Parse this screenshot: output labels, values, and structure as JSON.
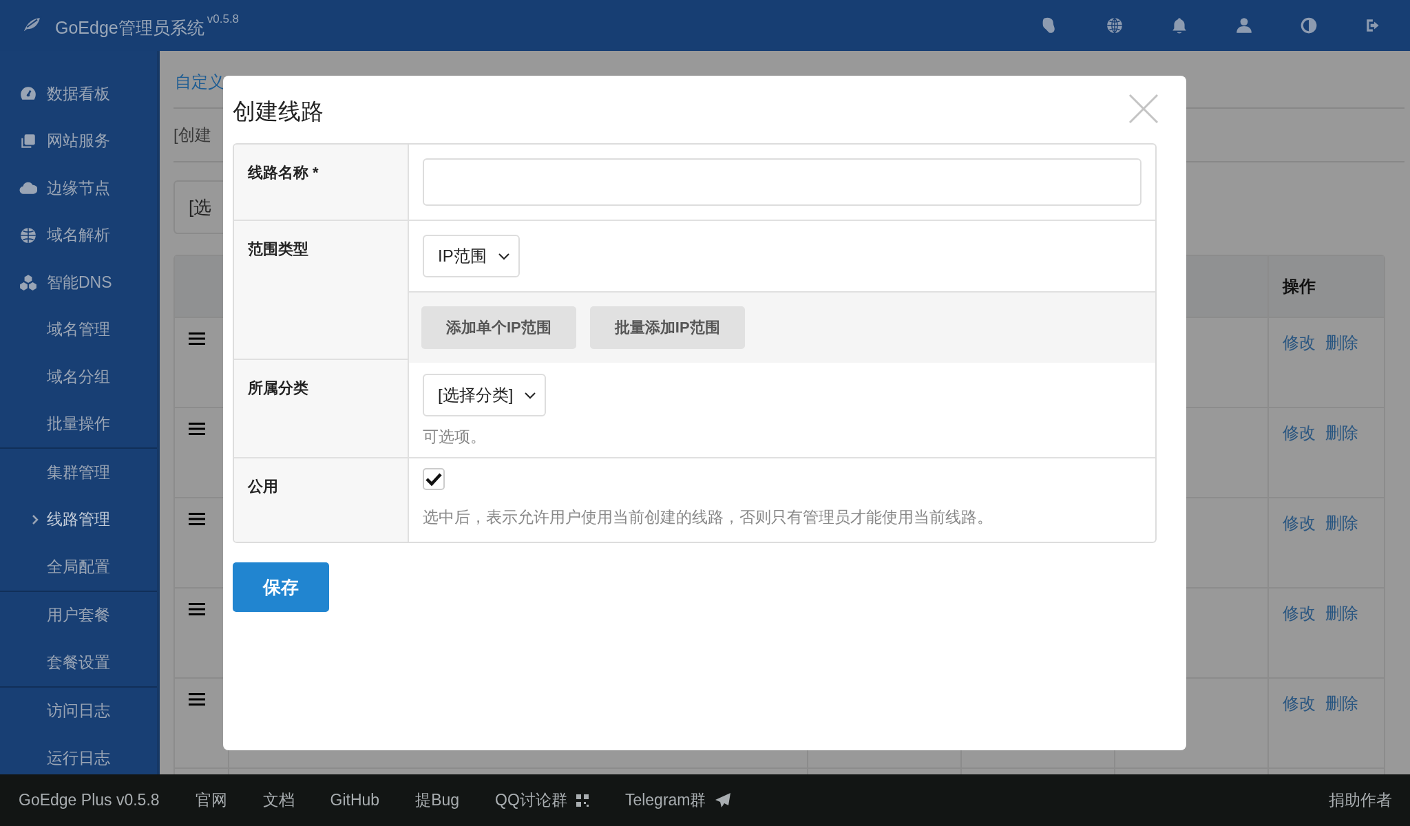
{
  "topbar": {
    "title": "GoEdge管理员系统",
    "version": "v0.5.8"
  },
  "sidebar": {
    "sections": [
      {
        "items": [
          {
            "kind": "main",
            "label": "数据看板",
            "selected": false
          },
          {
            "kind": "main",
            "label": "网站服务",
            "selected": false
          },
          {
            "kind": "main",
            "label": "边缘节点",
            "selected": false
          },
          {
            "kind": "main",
            "label": "域名解析",
            "selected": false
          },
          {
            "kind": "main",
            "label": "智能DNS",
            "selected": false
          },
          {
            "kind": "sub",
            "label": "域名管理",
            "selected": false
          },
          {
            "kind": "sub",
            "label": "域名分组",
            "selected": false
          },
          {
            "kind": "sub",
            "label": "批量操作",
            "selected": false
          }
        ]
      },
      {
        "items": [
          {
            "kind": "sub",
            "label": "集群管理",
            "selected": false
          },
          {
            "kind": "sub",
            "label": "线路管理",
            "selected": true
          },
          {
            "kind": "sub",
            "label": "全局配置",
            "selected": false
          }
        ]
      },
      {
        "items": [
          {
            "kind": "sub",
            "label": "用户套餐",
            "selected": false
          },
          {
            "kind": "sub",
            "label": "套餐设置",
            "selected": false
          }
        ]
      },
      {
        "items": [
          {
            "kind": "sub",
            "label": "访问日志",
            "selected": false
          },
          {
            "kind": "sub",
            "label": "运行日志",
            "selected": false
          }
        ]
      }
    ]
  },
  "main": {
    "breadcrumb": "自定义",
    "create_link": "[创建",
    "category_select": "[选",
    "table": {
      "action_header": "操作",
      "rows": [
        {
          "actions": [
            "修改",
            "删除"
          ]
        },
        {
          "actions": [
            "修改",
            "删除"
          ]
        },
        {
          "actions": [
            "修改",
            "删除"
          ]
        },
        {
          "actions": [
            "修改",
            "删除"
          ]
        },
        {
          "actions": [
            "修改",
            "删除"
          ]
        }
      ]
    }
  },
  "modal": {
    "title": "创建线路",
    "fields": [
      {
        "kind": "text",
        "label": "线路名称 *"
      },
      {
        "kind": "select",
        "label": "范围类型",
        "value": "IP范围",
        "buttons": [
          "添加单个IP范围",
          "批量添加IP范围"
        ]
      },
      {
        "kind": "select",
        "label": "所属分类",
        "value": "[选择分类]",
        "hint": "可选项。"
      },
      {
        "kind": "checkbox",
        "label": "公用",
        "checked": true,
        "hint": "选中后，表示允许用户使用当前创建的线路，否则只有管理员才能使用当前线路。"
      }
    ],
    "save_button": "保存"
  },
  "footer": {
    "links": [
      {
        "kind": "plain",
        "label": "GoEdge Plus v0.5.8"
      },
      {
        "kind": "plain",
        "label": "官网"
      },
      {
        "kind": "plain",
        "label": "文档"
      },
      {
        "kind": "plain",
        "label": "GitHub"
      },
      {
        "kind": "plain",
        "label": "提Bug"
      },
      {
        "kind": "qr",
        "label": "QQ讨论群"
      },
      {
        "kind": "send",
        "label": "Telegram群"
      }
    ],
    "right_link": "捐助作者"
  }
}
